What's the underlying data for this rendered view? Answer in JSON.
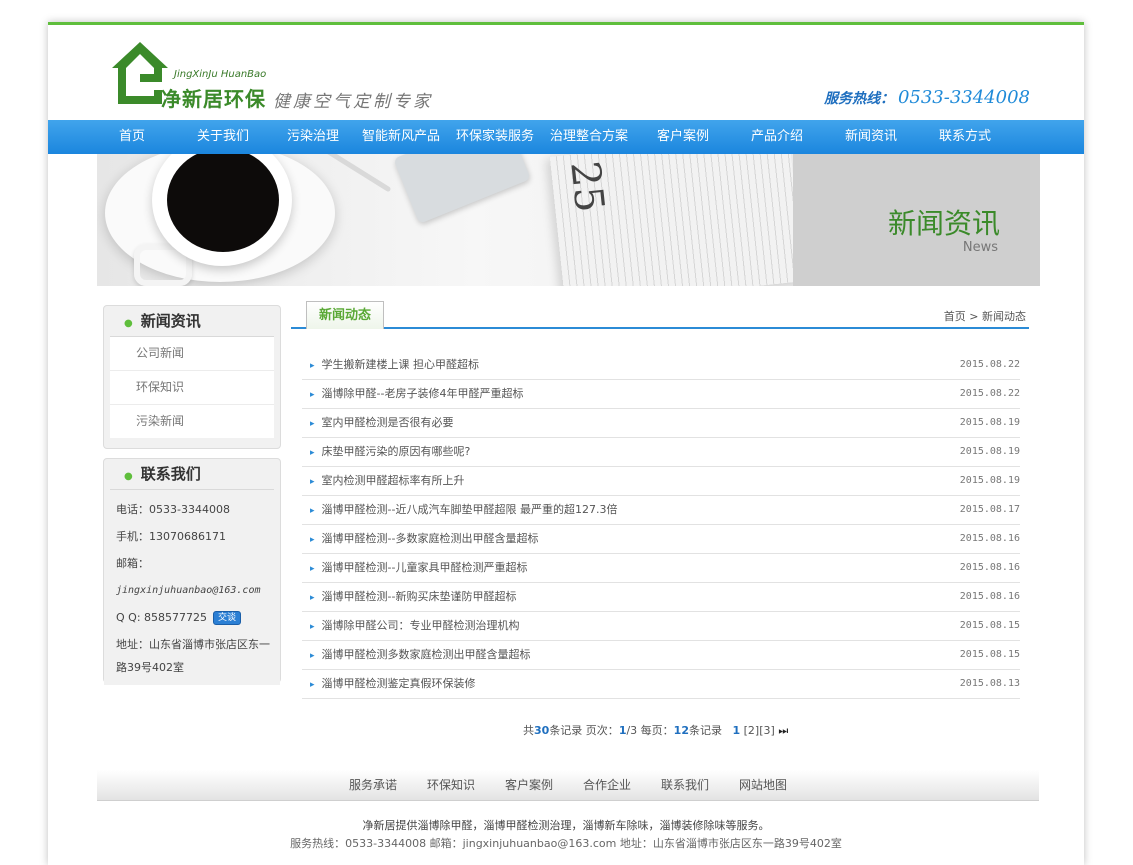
{
  "header": {
    "logo_pinyin": "JingXinJu HuanBao",
    "logo_cn": "净新居环保",
    "slogan": "健康空气定制专家",
    "hotline_label": "服务热线：",
    "hotline_number": "0533-3344008"
  },
  "nav": [
    "首页",
    "关于我们",
    "污染治理",
    "智能新风产品",
    "环保家装服务",
    "治理整合方案",
    "客户案例",
    "产品介绍",
    "新闻资讯",
    "联系方式"
  ],
  "banner": {
    "title": "新闻资讯",
    "subtitle": "News",
    "paper_text": "25"
  },
  "sidebar": {
    "news_title": "新闻资讯",
    "news_links": [
      "公司新闻",
      "环保知识",
      "污染新闻"
    ],
    "contact_title": "联系我们",
    "phone": "电话：0533-3344008",
    "mobile": "手机：13070686171",
    "email_label": "邮箱：",
    "email": "jingxinjuhuanbao@163.com",
    "qq": "Q Q:  858577725",
    "qq_button": "交谈",
    "address": "地址：山东省淄博市张店区东一路39号402室"
  },
  "main": {
    "tab": "新闻动态",
    "breadcrumb": "首页 > 新闻动态",
    "articles": [
      {
        "title": "学生搬新建楼上课 担心甲醛超标",
        "date": "2015.08.22"
      },
      {
        "title": "淄博除甲醛--老房子装修4年甲醛严重超标",
        "date": "2015.08.22"
      },
      {
        "title": "室内甲醛检测是否很有必要",
        "date": "2015.08.19"
      },
      {
        "title": "床垫甲醛污染的原因有哪些呢?",
        "date": "2015.08.19"
      },
      {
        "title": "室内检测甲醛超标率有所上升",
        "date": "2015.08.19"
      },
      {
        "title": "淄博甲醛检测--近八成汽车脚垫甲醛超限 最严重的超127.3倍",
        "date": "2015.08.17"
      },
      {
        "title": "淄博甲醛检测--多数家庭检测出甲醛含量超标",
        "date": "2015.08.16"
      },
      {
        "title": "淄博甲醛检测--儿童家具甲醛检测严重超标",
        "date": "2015.08.16"
      },
      {
        "title": "淄博甲醛检测--新购买床垫谨防甲醛超标",
        "date": "2015.08.16"
      },
      {
        "title": "淄博除甲醛公司：专业甲醛检测治理机构",
        "date": "2015.08.15"
      },
      {
        "title": "淄博甲醛检测多数家庭检测出甲醛含量超标",
        "date": "2015.08.15"
      },
      {
        "title": "淄博甲醛检测鉴定真假环保装修",
        "date": "2015.08.13"
      }
    ],
    "pager": {
      "total_prefix": "共",
      "total": "30",
      "total_suffix": "条记录  页次：",
      "current": "1",
      "of": "/3  每页：",
      "per_page": "12",
      "per_suffix": "条记录",
      "pages": [
        "1",
        "[2]",
        "[3]"
      ],
      "last": "⏭"
    }
  },
  "footer": {
    "links": [
      "服务承诺",
      "环保知识",
      "客户案例",
      "合作企业",
      "联系我们",
      "网站地图"
    ],
    "line1": "净新居提供淄博除甲醛，淄博甲醛检测治理，淄博新车除味，淄博装修除味等服务。",
    "line2": "服务热线：0533-3344008  邮箱：jingxinjuhuanbao@163.com  地址：山东省淄博市张店区东一路39号402室"
  },
  "colors": {
    "accent_green": "#5fbe3c",
    "nav_blue": "#1b86de",
    "link_blue": "#1f6fbf"
  }
}
